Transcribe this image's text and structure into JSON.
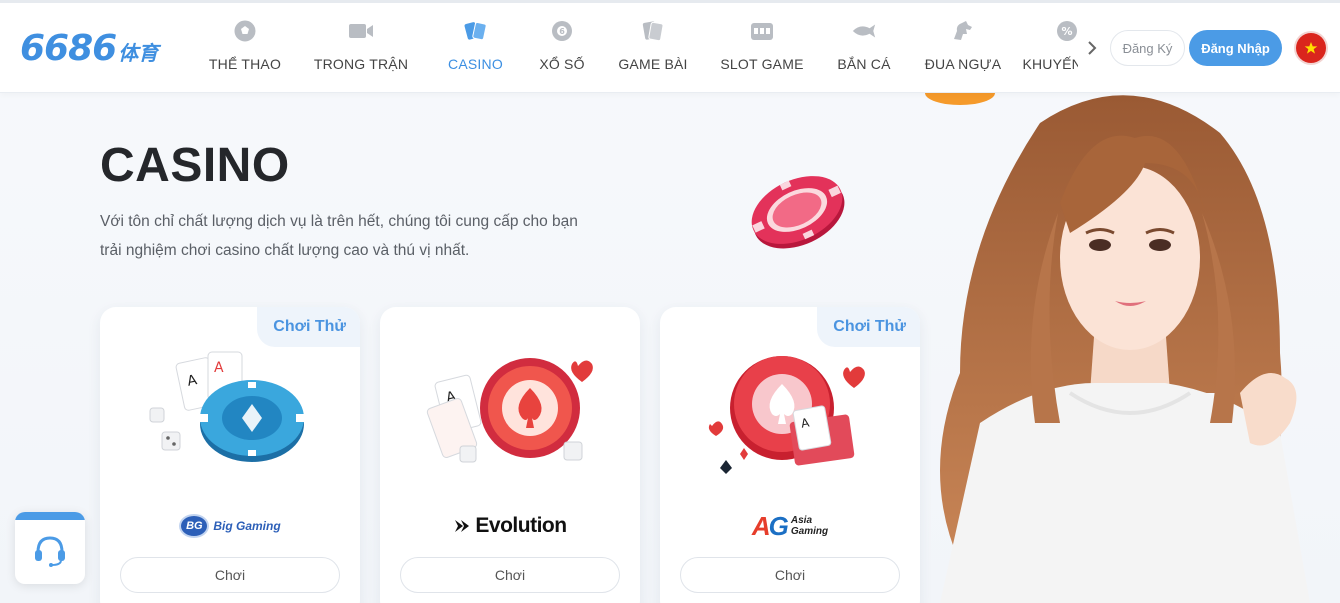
{
  "header": {
    "logo_number": "6686",
    "logo_suffix": "体育",
    "nav": [
      {
        "label": "THỂ THAO",
        "icon": "soccer-ball-icon"
      },
      {
        "label": "TRONG TRẬN",
        "icon": "video-camera-icon"
      },
      {
        "label": "CASINO",
        "icon": "playing-cards-icon",
        "active": true
      },
      {
        "label": "XỔ SỐ",
        "icon": "lottery-ball-icon"
      },
      {
        "label": "GAME BÀI",
        "icon": "card-game-icon"
      },
      {
        "label": "SLOT GAME",
        "icon": "slot-machine-icon"
      },
      {
        "label": "BẮN CÁ",
        "icon": "fish-icon"
      },
      {
        "label": "ĐUA NGỰA",
        "icon": "horse-icon"
      },
      {
        "label": "KHUYẾN MÃI",
        "icon": "promotion-icon"
      }
    ],
    "register_label": "Đăng Ký",
    "login_label": "Đăng Nhập",
    "language": "vietnam-flag-icon"
  },
  "hero": {
    "title": "CASINO",
    "description": "Với tôn chỉ chất lượng dịch vụ là trên hết, chúng tôi cung cấp cho bạn trải nghiệm chơi casino chất lượng cao và thú vị nhất."
  },
  "cards": [
    {
      "badge": "Chơi Thử",
      "provider_short": "BG",
      "provider_name": "Big Gaming",
      "play_label": "Chơi"
    },
    {
      "provider_name": "Evolution",
      "play_label": "Chơi"
    },
    {
      "badge": "Chơi Thử",
      "provider_short_a": "A",
      "provider_short_g": "G",
      "provider_line1": "Asia",
      "provider_line2": "Gaming",
      "play_label": "Chơi"
    }
  ],
  "colors": {
    "accent": "#4b9be6",
    "active_nav": "#3c8fe2",
    "title": "#25272b",
    "badge_text": "#4b94e0"
  }
}
